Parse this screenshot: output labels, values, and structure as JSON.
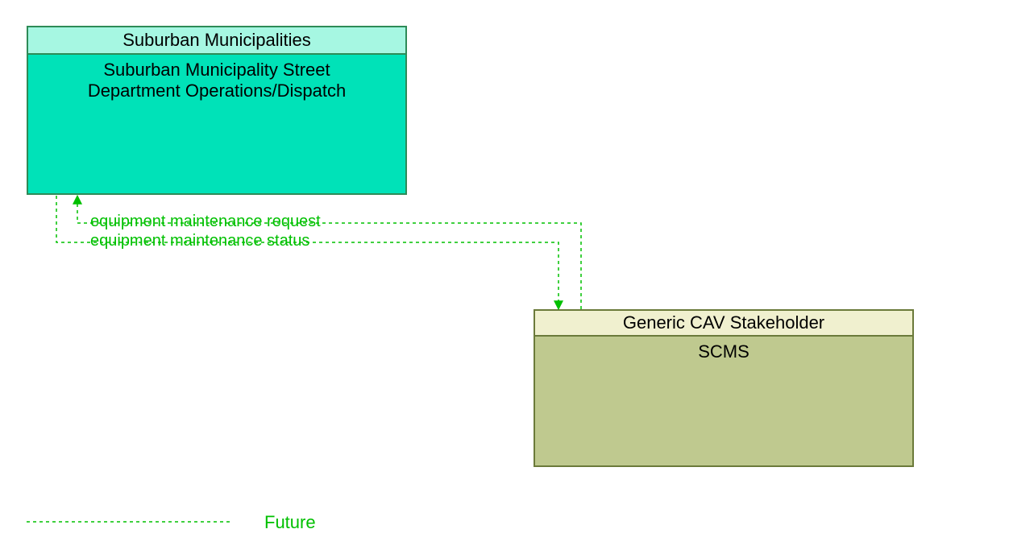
{
  "diagram": {
    "box_a": {
      "header": "Suburban Municipalities",
      "body_line1": "Suburban Municipality Street",
      "body_line2": "Department Operations/Dispatch",
      "header_bg": "#a6f7e2",
      "body_bg": "#00e2b8",
      "border": "#2e8b57"
    },
    "box_b": {
      "header": "Generic CAV Stakeholder",
      "body": "SCMS",
      "header_bg": "#f0f0cf",
      "body_bg": "#bfc98f",
      "border": "#6b7a3a"
    },
    "flows": {
      "to_a": "equipment maintenance request",
      "to_b": "equipment maintenance status",
      "color": "#00c000"
    },
    "legend": {
      "label": "Future"
    }
  }
}
